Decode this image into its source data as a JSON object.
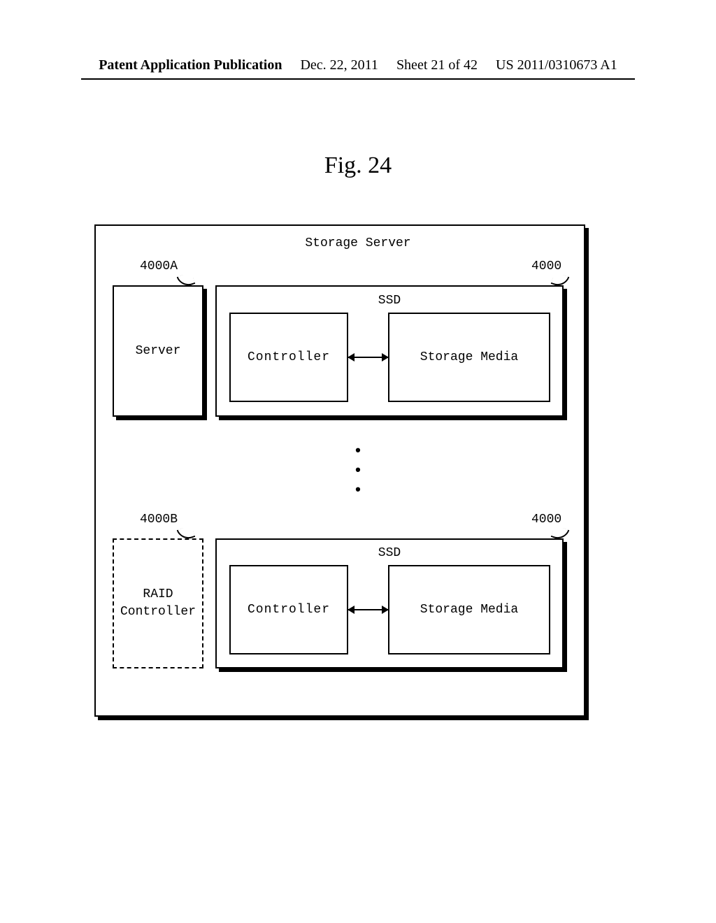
{
  "header": {
    "publication": "Patent Application Publication",
    "date": "Dec. 22, 2011",
    "sheet": "Sheet 21 of 42",
    "pubno": "US 2011/0310673 A1"
  },
  "figure": {
    "label": "Fig. 24",
    "title": "Storage Server",
    "callouts": {
      "server": "4000A",
      "ssd_top": "4000",
      "raid": "4000B",
      "ssd_bot": "4000"
    },
    "blocks": {
      "server": "Server",
      "ssd_label": "SSD",
      "controller": "Controller",
      "storage_media": "Storage Media",
      "raid_controller": "RAID\nController"
    }
  }
}
